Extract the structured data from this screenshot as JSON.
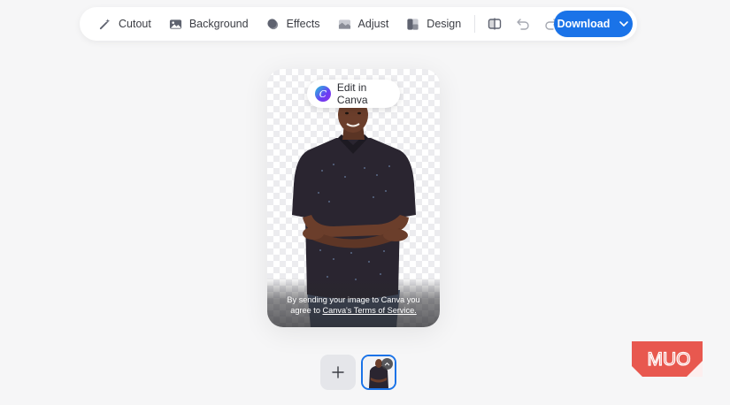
{
  "toolbar": {
    "tools": [
      {
        "label": "Cutout",
        "icon": "magic-wand-icon"
      },
      {
        "label": "Background",
        "icon": "image-icon"
      },
      {
        "label": "Effects",
        "icon": "effects-icon"
      },
      {
        "label": "Adjust",
        "icon": "adjust-icon"
      },
      {
        "label": "Design",
        "icon": "design-icon"
      }
    ],
    "compare_icon": "compare-icon",
    "undo_icon": "undo-icon",
    "redo_icon": "redo-icon",
    "download_label": "Download"
  },
  "canvas": {
    "edit_label": "Edit in Canva",
    "terms_line1": "By sending your image to Canva you",
    "terms_line2_prefix": "agree to ",
    "terms_link": "Canva's Terms of Service."
  },
  "watermark": {
    "text": "MUO"
  },
  "colors": {
    "accent": "#1a73e8",
    "shirt": "#2a2530",
    "watermark": "#e8584f"
  }
}
